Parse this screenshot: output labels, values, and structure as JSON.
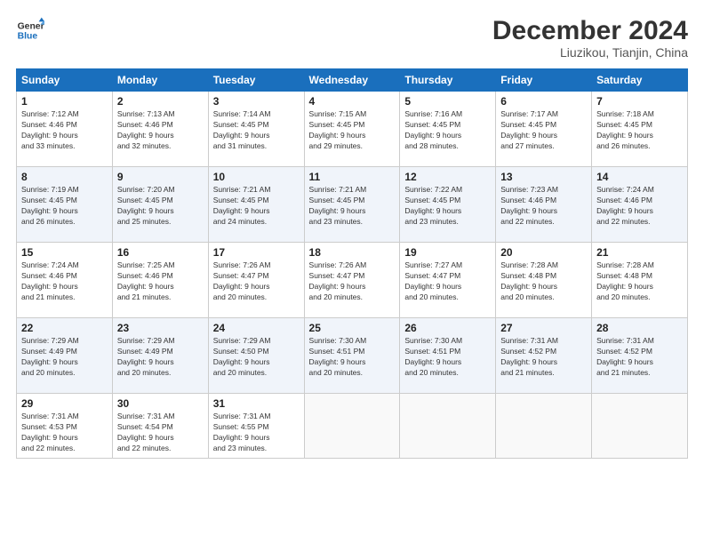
{
  "header": {
    "logo_line1": "General",
    "logo_line2": "Blue",
    "month": "December 2024",
    "location": "Liuzikou, Tianjin, China"
  },
  "weekdays": [
    "Sunday",
    "Monday",
    "Tuesday",
    "Wednesday",
    "Thursday",
    "Friday",
    "Saturday"
  ],
  "weeks": [
    [
      {
        "day": "1",
        "info": "Sunrise: 7:12 AM\nSunset: 4:46 PM\nDaylight: 9 hours\nand 33 minutes."
      },
      {
        "day": "2",
        "info": "Sunrise: 7:13 AM\nSunset: 4:46 PM\nDaylight: 9 hours\nand 32 minutes."
      },
      {
        "day": "3",
        "info": "Sunrise: 7:14 AM\nSunset: 4:45 PM\nDaylight: 9 hours\nand 31 minutes."
      },
      {
        "day": "4",
        "info": "Sunrise: 7:15 AM\nSunset: 4:45 PM\nDaylight: 9 hours\nand 29 minutes."
      },
      {
        "day": "5",
        "info": "Sunrise: 7:16 AM\nSunset: 4:45 PM\nDaylight: 9 hours\nand 28 minutes."
      },
      {
        "day": "6",
        "info": "Sunrise: 7:17 AM\nSunset: 4:45 PM\nDaylight: 9 hours\nand 27 minutes."
      },
      {
        "day": "7",
        "info": "Sunrise: 7:18 AM\nSunset: 4:45 PM\nDaylight: 9 hours\nand 26 minutes."
      }
    ],
    [
      {
        "day": "8",
        "info": "Sunrise: 7:19 AM\nSunset: 4:45 PM\nDaylight: 9 hours\nand 26 minutes."
      },
      {
        "day": "9",
        "info": "Sunrise: 7:20 AM\nSunset: 4:45 PM\nDaylight: 9 hours\nand 25 minutes."
      },
      {
        "day": "10",
        "info": "Sunrise: 7:21 AM\nSunset: 4:45 PM\nDaylight: 9 hours\nand 24 minutes."
      },
      {
        "day": "11",
        "info": "Sunrise: 7:21 AM\nSunset: 4:45 PM\nDaylight: 9 hours\nand 23 minutes."
      },
      {
        "day": "12",
        "info": "Sunrise: 7:22 AM\nSunset: 4:45 PM\nDaylight: 9 hours\nand 23 minutes."
      },
      {
        "day": "13",
        "info": "Sunrise: 7:23 AM\nSunset: 4:46 PM\nDaylight: 9 hours\nand 22 minutes."
      },
      {
        "day": "14",
        "info": "Sunrise: 7:24 AM\nSunset: 4:46 PM\nDaylight: 9 hours\nand 22 minutes."
      }
    ],
    [
      {
        "day": "15",
        "info": "Sunrise: 7:24 AM\nSunset: 4:46 PM\nDaylight: 9 hours\nand 21 minutes."
      },
      {
        "day": "16",
        "info": "Sunrise: 7:25 AM\nSunset: 4:46 PM\nDaylight: 9 hours\nand 21 minutes."
      },
      {
        "day": "17",
        "info": "Sunrise: 7:26 AM\nSunset: 4:47 PM\nDaylight: 9 hours\nand 20 minutes."
      },
      {
        "day": "18",
        "info": "Sunrise: 7:26 AM\nSunset: 4:47 PM\nDaylight: 9 hours\nand 20 minutes."
      },
      {
        "day": "19",
        "info": "Sunrise: 7:27 AM\nSunset: 4:47 PM\nDaylight: 9 hours\nand 20 minutes."
      },
      {
        "day": "20",
        "info": "Sunrise: 7:28 AM\nSunset: 4:48 PM\nDaylight: 9 hours\nand 20 minutes."
      },
      {
        "day": "21",
        "info": "Sunrise: 7:28 AM\nSunset: 4:48 PM\nDaylight: 9 hours\nand 20 minutes."
      }
    ],
    [
      {
        "day": "22",
        "info": "Sunrise: 7:29 AM\nSunset: 4:49 PM\nDaylight: 9 hours\nand 20 minutes."
      },
      {
        "day": "23",
        "info": "Sunrise: 7:29 AM\nSunset: 4:49 PM\nDaylight: 9 hours\nand 20 minutes."
      },
      {
        "day": "24",
        "info": "Sunrise: 7:29 AM\nSunset: 4:50 PM\nDaylight: 9 hours\nand 20 minutes."
      },
      {
        "day": "25",
        "info": "Sunrise: 7:30 AM\nSunset: 4:51 PM\nDaylight: 9 hours\nand 20 minutes."
      },
      {
        "day": "26",
        "info": "Sunrise: 7:30 AM\nSunset: 4:51 PM\nDaylight: 9 hours\nand 20 minutes."
      },
      {
        "day": "27",
        "info": "Sunrise: 7:31 AM\nSunset: 4:52 PM\nDaylight: 9 hours\nand 21 minutes."
      },
      {
        "day": "28",
        "info": "Sunrise: 7:31 AM\nSunset: 4:52 PM\nDaylight: 9 hours\nand 21 minutes."
      }
    ],
    [
      {
        "day": "29",
        "info": "Sunrise: 7:31 AM\nSunset: 4:53 PM\nDaylight: 9 hours\nand 22 minutes."
      },
      {
        "day": "30",
        "info": "Sunrise: 7:31 AM\nSunset: 4:54 PM\nDaylight: 9 hours\nand 22 minutes."
      },
      {
        "day": "31",
        "info": "Sunrise: 7:31 AM\nSunset: 4:55 PM\nDaylight: 9 hours\nand 23 minutes."
      },
      {
        "day": "",
        "info": ""
      },
      {
        "day": "",
        "info": ""
      },
      {
        "day": "",
        "info": ""
      },
      {
        "day": "",
        "info": ""
      }
    ]
  ]
}
